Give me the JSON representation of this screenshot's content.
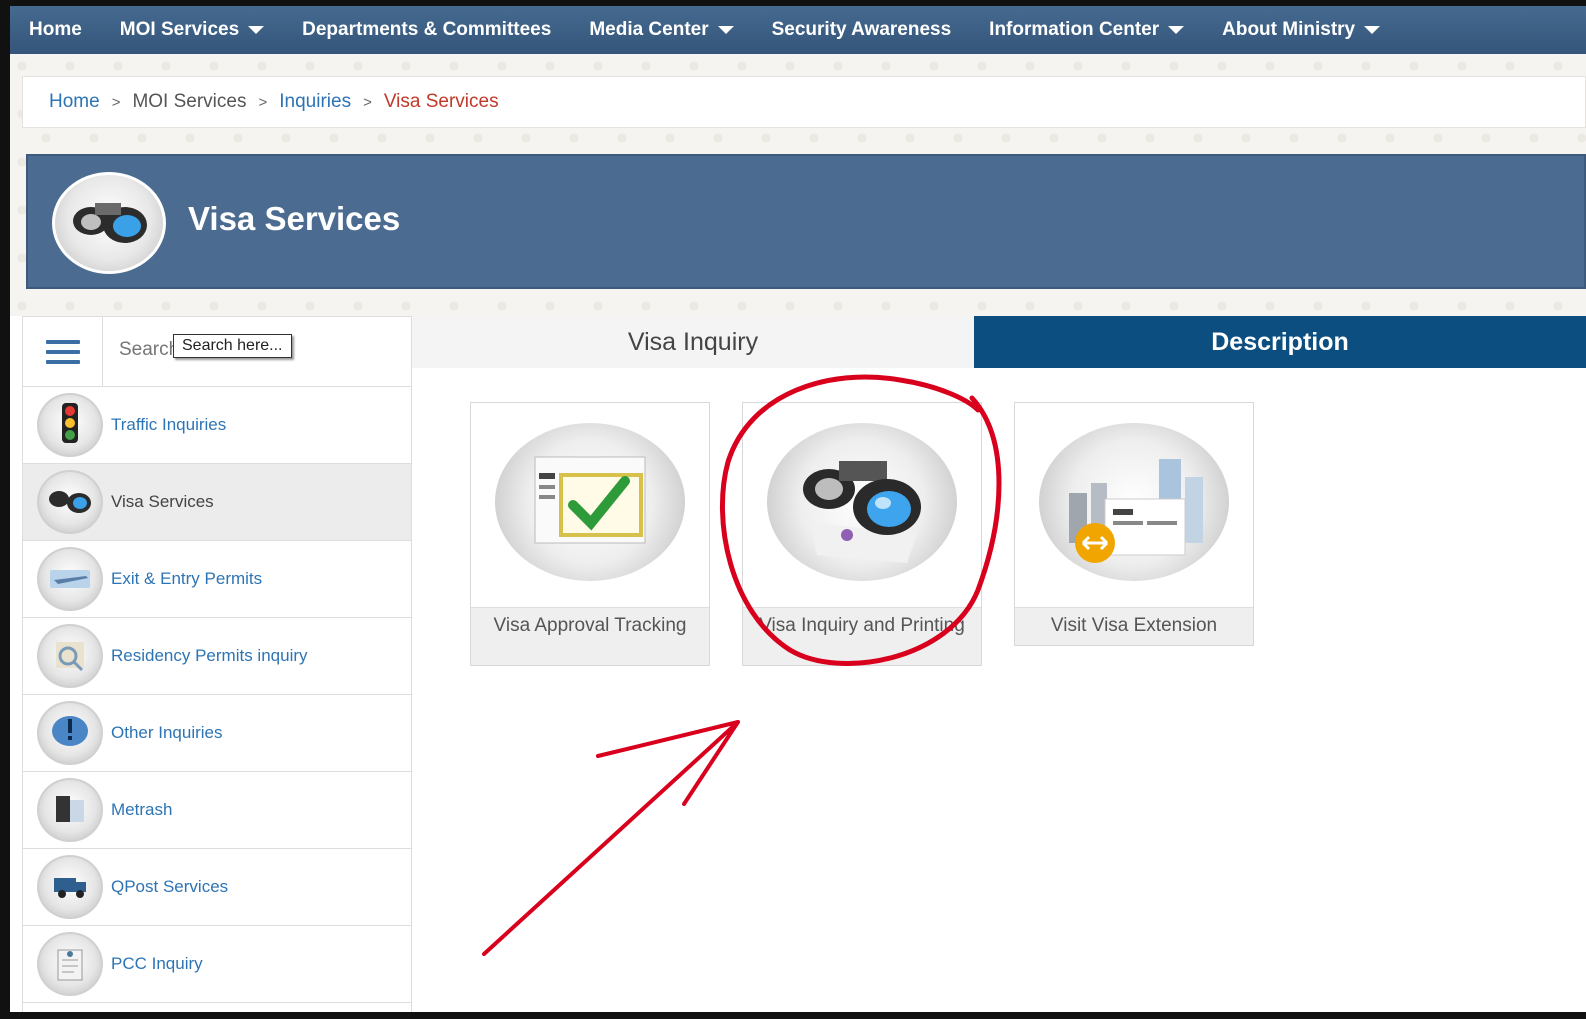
{
  "nav": {
    "items": [
      {
        "label": "Home",
        "dropdown": false
      },
      {
        "label": "MOI Services",
        "dropdown": true
      },
      {
        "label": "Departments & Committees",
        "dropdown": false
      },
      {
        "label": "Media Center",
        "dropdown": true
      },
      {
        "label": "Security Awareness",
        "dropdown": false
      },
      {
        "label": "Information Center",
        "dropdown": true
      },
      {
        "label": "About Ministry",
        "dropdown": true
      }
    ]
  },
  "breadcrumb": {
    "items": [
      "Home",
      "MOI Services",
      "Inquiries"
    ],
    "current": "Visa Services",
    "separator": ">"
  },
  "banner": {
    "title": "Visa Services",
    "icon": "binoculars-icon"
  },
  "sidebar": {
    "search_placeholder": "Search",
    "search_tooltip": "Search here...",
    "items": [
      {
        "label": "Traffic Inquiries",
        "icon": "traffic-light-icon",
        "active": false
      },
      {
        "label": "Visa Services",
        "icon": "binoculars-icon",
        "active": true
      },
      {
        "label": "Exit & Entry Permits",
        "icon": "airplane-icon",
        "active": false
      },
      {
        "label": "Residency Permits inquiry",
        "icon": "magnifier-icon",
        "active": false
      },
      {
        "label": "Other Inquiries",
        "icon": "exclamation-icon",
        "active": false
      },
      {
        "label": "Metrash",
        "icon": "metrash-icon",
        "active": false
      },
      {
        "label": "QPost Services",
        "icon": "delivery-truck-icon",
        "active": false
      },
      {
        "label": "PCC Inquiry",
        "icon": "certificate-icon",
        "active": false
      }
    ]
  },
  "tabs": {
    "inquiry": "Visa Inquiry",
    "description": "Description"
  },
  "cards": [
    {
      "label": "Visa Approval Tracking",
      "icon": "approval-checkmark-icon"
    },
    {
      "label": "Visa Inquiry and Printing",
      "icon": "binoculars-icon"
    },
    {
      "label": "Visit Visa Extension",
      "icon": "city-document-icon"
    }
  ],
  "colors": {
    "nav_bg": "#3e5f82",
    "banner_bg": "#4b6c90",
    "tab_active_bg": "#0c4e80",
    "link": "#2d74b5",
    "breadcrumb_current": "#c0392b",
    "annotation": "#d8001c"
  }
}
